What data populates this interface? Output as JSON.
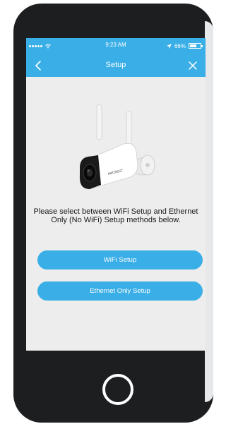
{
  "status_bar": {
    "time": "9:23 AM",
    "battery": "66%",
    "battery_level": 0.66,
    "icons": [
      "signal-dots-icon",
      "wifi-icon",
      "location-arrow-icon",
      "battery-icon"
    ]
  },
  "nav": {
    "title": "Setup",
    "back_icon": "chevron-left-icon",
    "close_icon": "close-icon"
  },
  "content": {
    "image": "security-camera-illustration",
    "camera_brand": "AMCREST",
    "prompt": "Please select between WiFi Setup and Ethernet Only (No WiFi) Setup methods below.",
    "buttons": {
      "wifi": "WiFi Setup",
      "ethernet": "Ethernet Only Setup"
    }
  },
  "colors": {
    "accent": "#3aaee6",
    "screen_background": "#ededed",
    "phone_body": "#1d1e20"
  }
}
